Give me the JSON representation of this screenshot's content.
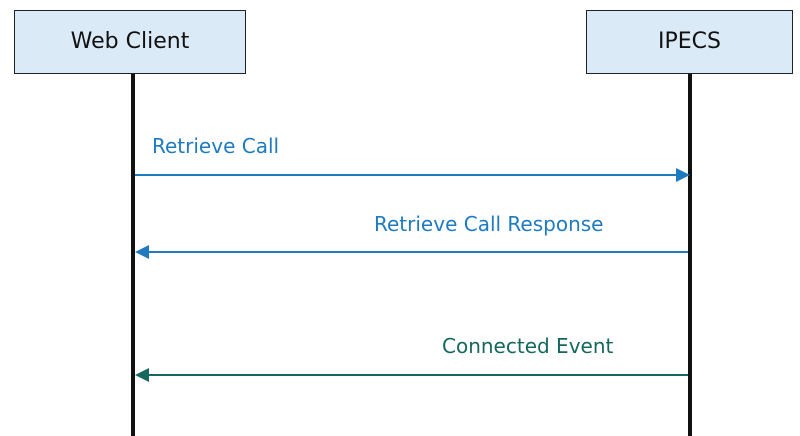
{
  "participants": [
    {
      "label": "Web Client"
    },
    {
      "label": "IPECS"
    }
  ],
  "messages": [
    {
      "label": "Retrieve Call",
      "from": "Web Client",
      "to": "IPECS",
      "color": "#1f7bc0"
    },
    {
      "label": "Retrieve Call Response",
      "from": "IPECS",
      "to": "Web Client",
      "color": "#1f7bc0"
    },
    {
      "label": "Connected Event",
      "from": "IPECS",
      "to": "Web Client",
      "color": "#16685f"
    }
  ]
}
